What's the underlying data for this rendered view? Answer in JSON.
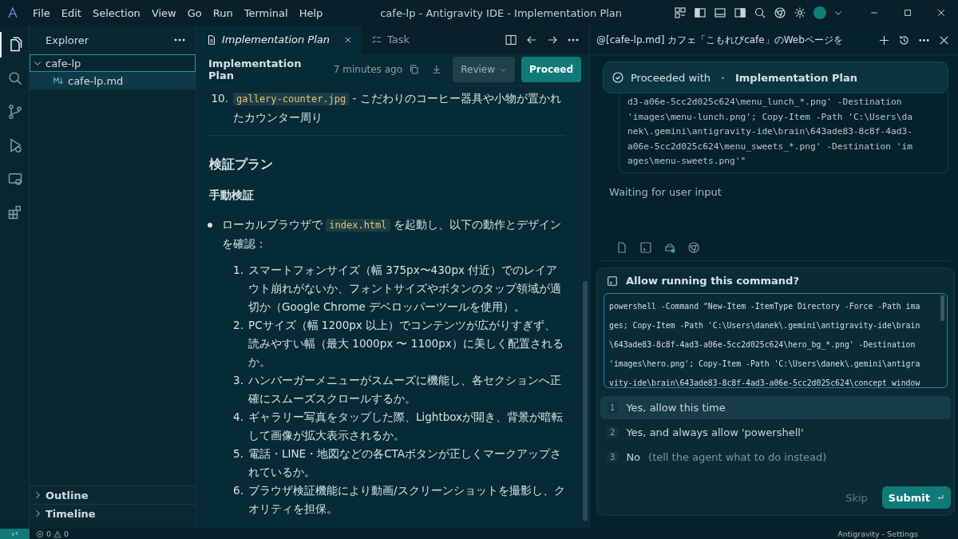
{
  "title_bar": {
    "menu": [
      "File",
      "Edit",
      "Selection",
      "View",
      "Go",
      "Run",
      "Terminal",
      "Help"
    ],
    "title": "cafe-lp - Antigravity IDE - Implementation Plan"
  },
  "activity_bar": {
    "items": [
      {
        "kind": "files",
        "selected": true
      },
      {
        "kind": "search",
        "selected": false
      },
      {
        "kind": "branch",
        "selected": false
      },
      {
        "kind": "debug",
        "selected": false
      },
      {
        "kind": "remote",
        "selected": false
      },
      {
        "kind": "extensions",
        "selected": false
      }
    ]
  },
  "explorer": {
    "title": "Explorer",
    "tree": [
      {
        "label": "cafe-lp",
        "expanded": true,
        "children": [
          {
            "label": "cafe-lp.md",
            "selected": true
          }
        ]
      }
    ],
    "sections": [
      {
        "label": "Outline",
        "expanded": false
      },
      {
        "label": "Timeline",
        "expanded": false
      }
    ]
  },
  "editor": {
    "tabs": [
      {
        "label": "Implementation Plan",
        "kind": "doc",
        "selected": true
      },
      {
        "label": "Task",
        "kind": "checklist",
        "selected": false
      }
    ],
    "header": {
      "title": "Implementation Plan",
      "time": "7 minutes ago",
      "review": "Review",
      "proceed": "Proceed"
    },
    "content": [
      {
        "kind": "numbered",
        "number": "10.",
        "code": "gallery-counter.jpg",
        "text": " - こだわりのコーヒー器具や小物が置かれたカウンター周り"
      },
      {
        "kind": "rule"
      },
      {
        "kind": "h2",
        "text": "検証プラン"
      },
      {
        "kind": "h3",
        "text": "手動検証"
      },
      {
        "kind": "bullet",
        "before": "ローカルブラウザで ",
        "code": "index.html",
        "text": " を起動し、以下の動作とデザインを確認：",
        "children": [
          {
            "number": "1.",
            "text": "スマートフォンサイズ（幅 375px〜430px 付近）でのレイアウト崩れがないか、フォントサイズやボタンのタップ領域が適切か（Google Chrome デベロッパーツールを使用）。"
          },
          {
            "number": "2.",
            "text": "PCサイズ（幅 1200px 以上）でコンテンツが広がりすぎず、読みやすい幅（最大 1000px 〜 1100px）に美しく配置されるか。"
          },
          {
            "number": "3.",
            "text": "ハンバーガーメニューがスムーズに機能し、各セクションへ正確にスムーズスクロールするか。"
          },
          {
            "number": "4.",
            "text": "ギャラリー写真をタップした際、Lightboxが開き、背景が暗転して画像が拡大表示されるか。"
          },
          {
            "number": "5.",
            "text": "電話・LINE・地図などの各CTAボタンが正しくマークアップされているか。"
          },
          {
            "number": "6.",
            "text": "ブラウザ検証機能により動画/スクリーンショットを撮影し、クオリティを担保。"
          }
        ]
      }
    ]
  },
  "agent": {
    "header": "@[cafe-lp.md] カフェ「こもれびcafe」のWebページを",
    "proceeded": {
      "label": "Proceeded with",
      "target": "Implementation Plan"
    },
    "previous_command": [
      "d3-a06e-5cc2d025c624\\menu_lunch_*.png' -Destination",
      "'images\\menu-lunch.png'; Copy-Item -Path 'C:\\Users\\da",
      "nek\\.gemini\\antigravity-ide\\brain\\643ade83-8c8f-4ad3-",
      "a06e-5cc2d025c624\\menu_sweets_*.png' -Destination 'im",
      "ages\\menu-sweets.png'\""
    ],
    "status": "Waiting for user input",
    "prompt": {
      "title": "Allow running this command?",
      "command": [
        "powershell -Command \"New-Item -ItemType Directory -Force -Path ima",
        "ges; Copy-Item -Path 'C:\\Users\\danek\\.gemini\\antigravity-ide\\brain",
        "\\643ade83-8c8f-4ad3-a06e-5cc2d025c624\\hero_bg_*.png' -Destination",
        "'images\\hero.png'; Copy-Item -Path 'C:\\Users\\danek\\.gemini\\antigra",
        "vity-ide\\brain\\643ade83-8c8f-4ad3-a06e-5cc2d025c624\\concept_window"
      ],
      "options": [
        {
          "number": "1",
          "label": "Yes, allow this time",
          "selected": true
        },
        {
          "number": "2",
          "label": "Yes, and always allow 'powershell'",
          "selected": false
        },
        {
          "number": "3",
          "label": "No",
          "hint": "(tell the agent what to do instead)",
          "selected": false
        }
      ],
      "skip": "Skip",
      "submit": "Submit"
    }
  },
  "status_bar": {
    "errors": "0",
    "warnings": "0",
    "right": "Antigravity - Settings"
  }
}
